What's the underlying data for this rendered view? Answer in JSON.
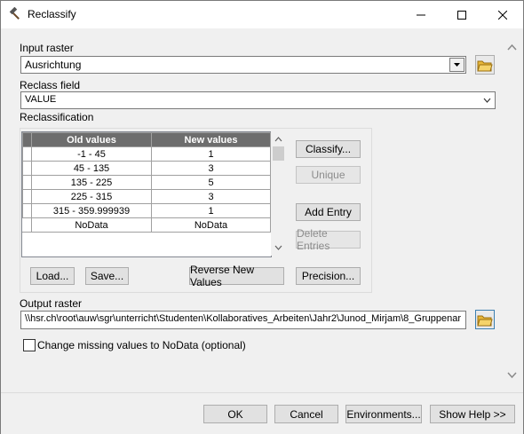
{
  "window": {
    "title": "Reclassify"
  },
  "input_raster": {
    "label": "Input raster",
    "value": "Ausrichtung"
  },
  "reclass_field": {
    "label": "Reclass field",
    "value": "VALUE"
  },
  "reclassification": {
    "label": "Reclassification",
    "headers": [
      "Old values",
      "New values"
    ],
    "rows": [
      [
        "-1 - 45",
        "1"
      ],
      [
        "45 - 135",
        "3"
      ],
      [
        "135 - 225",
        "5"
      ],
      [
        "225 - 315",
        "3"
      ],
      [
        "315 - 359.999939",
        "1"
      ],
      [
        "NoData",
        "NoData"
      ]
    ]
  },
  "side_buttons": {
    "classify": "Classify...",
    "unique": "Unique",
    "add_entry": "Add Entry",
    "delete_entries": "Delete Entries"
  },
  "grid_buttons": {
    "load": "Load...",
    "save": "Save...",
    "reverse": "Reverse New Values",
    "precision": "Precision..."
  },
  "output_raster": {
    "label": "Output raster",
    "value": "\\\\hsr.ch\\root\\auw\\sgr\\unterricht\\Studenten\\Kollaboratives_Arbeiten\\Jahr2\\Junod_Mirjam\\8_Gruppenar"
  },
  "nodata_option": {
    "label": "Change missing values to NoData (optional)",
    "checked": false
  },
  "footer": {
    "ok": "OK",
    "cancel": "Cancel",
    "environments": "Environments...",
    "show_help": "Show Help >>"
  },
  "icons": [
    "hammer-icon",
    "minimize-icon",
    "maximize-icon",
    "close-icon",
    "folder-open-icon",
    "chevron-down-icon",
    "chevron-up-icon"
  ],
  "colors": {
    "grid_header": "#6d6d6d",
    "folder": "#e8b73a"
  }
}
